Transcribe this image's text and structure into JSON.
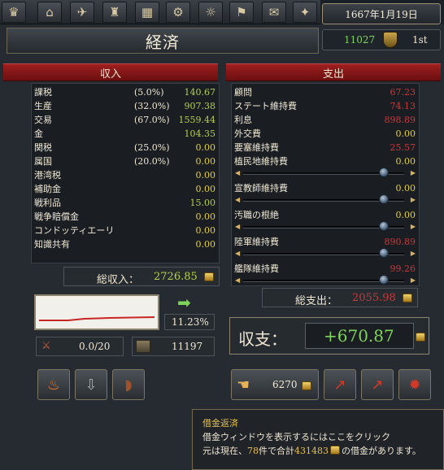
{
  "header": {
    "date": "1667年1月19日",
    "treasury_value": "11027",
    "rank": "1st",
    "title": "経済"
  },
  "toolbar": {
    "icons": [
      "crown-icon",
      "court-icon",
      "diplomacy-dove-icon",
      "military-icon",
      "trade-goods-icon",
      "production-gear-icon",
      "idea-lightbulb-icon",
      "flag-map-icon",
      "letter-scroll-icon",
      "religion-icon"
    ]
  },
  "income": {
    "header": "収入",
    "rows": [
      {
        "label": "課税",
        "pct": "(5.0%)",
        "value": "140.67"
      },
      {
        "label": "生産",
        "pct": "(32.0%)",
        "value": "907.38"
      },
      {
        "label": "交易",
        "pct": "(67.0%)",
        "value": "1559.44"
      },
      {
        "label": "金",
        "pct": "",
        "value": "104.35"
      },
      {
        "label": "関税",
        "pct": "(25.0%)",
        "value": "0.00"
      },
      {
        "label": "属国",
        "pct": "(20.0%)",
        "value": "0.00"
      },
      {
        "label": "港湾税",
        "pct": "",
        "value": "0.00"
      },
      {
        "label": "補助金",
        "pct": "",
        "value": "0.00"
      },
      {
        "label": "戦利品",
        "pct": "",
        "value": "15.00"
      },
      {
        "label": "戦争賠償金",
        "pct": "",
        "value": "0.00"
      },
      {
        "label": "コンドッティエーリ",
        "pct": "",
        "value": "0.00"
      },
      {
        "label": "知識共有",
        "pct": "",
        "value": "0.00"
      }
    ],
    "total_label": "総収入：",
    "total_value": "2726.85",
    "growth_pct": "11.23%"
  },
  "expense": {
    "header": "支出",
    "rows": [
      {
        "label": "顧問",
        "value": "67.23",
        "color": "red"
      },
      {
        "label": "ステート維持費",
        "value": "74.13",
        "color": "red"
      },
      {
        "label": "利息",
        "value": "898.89",
        "color": "red"
      },
      {
        "label": "外交費",
        "value": "0.00",
        "color": "yellow"
      },
      {
        "label": "要塞維持費",
        "value": "25.57",
        "color": "red"
      }
    ],
    "slider_rows": [
      {
        "label": "植民地維持費",
        "value": "0.00",
        "color": "yellow",
        "level": 0.9
      },
      {
        "label": "宣教師維持費",
        "value": "0.00",
        "color": "yellow",
        "level": 0.9
      },
      {
        "label": "汚職の根絶",
        "value": "0.00",
        "color": "yellow",
        "level": 0.9
      },
      {
        "label": "陸軍維持費",
        "value": "890.89",
        "color": "red",
        "level": 0.9
      },
      {
        "label": "艦隊維持費",
        "value": "99.26",
        "color": "red",
        "level": 0.9
      }
    ],
    "total_label": "総支出：",
    "total_value": "2055.98"
  },
  "balance": {
    "label": "収支：",
    "value": "+670.87"
  },
  "stats": {
    "inflation": "0.0/20",
    "loan_amount": "11197",
    "loan_button_value": "6270"
  },
  "tooltip": {
    "title": "借金返済",
    "line1": "借金ウィンドウを表示するにはここをクリック",
    "line2_prefix": "元は現在、",
    "loan_count": "78",
    "line2_mid": "件で合計",
    "loan_total": "431483",
    "line2_suffix": "の借金があります。"
  },
  "colors": {
    "positive": "#b4cf4d",
    "negative": "#c73a3a",
    "zero": "#e3cf3a",
    "ribbon": "#9f1f1f",
    "balance": "#7ed35a"
  }
}
